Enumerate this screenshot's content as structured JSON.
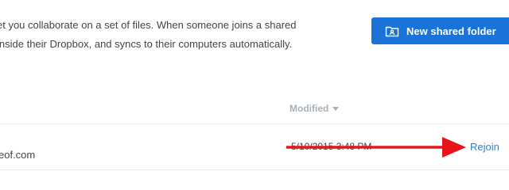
{
  "intro": {
    "line1": "et you collaborate on a set of files. When someone joins a shared",
    "line2": " inside their Dropbox, and syncs to their computers automatically."
  },
  "toolbar": {
    "new_shared_folder_label": "New shared folder"
  },
  "table": {
    "columns": {
      "modified": "Modified"
    },
    "rows": [
      {
        "email": "eof.com",
        "modified": "5/10/2015 3:48 PM",
        "action": "Rejoin"
      }
    ]
  },
  "annotation": {
    "arrow_color": "#e8141a"
  },
  "colors": {
    "button_bg": "#1a73d9",
    "link": "#2a7fd4",
    "header_text": "#a9b0b6"
  }
}
